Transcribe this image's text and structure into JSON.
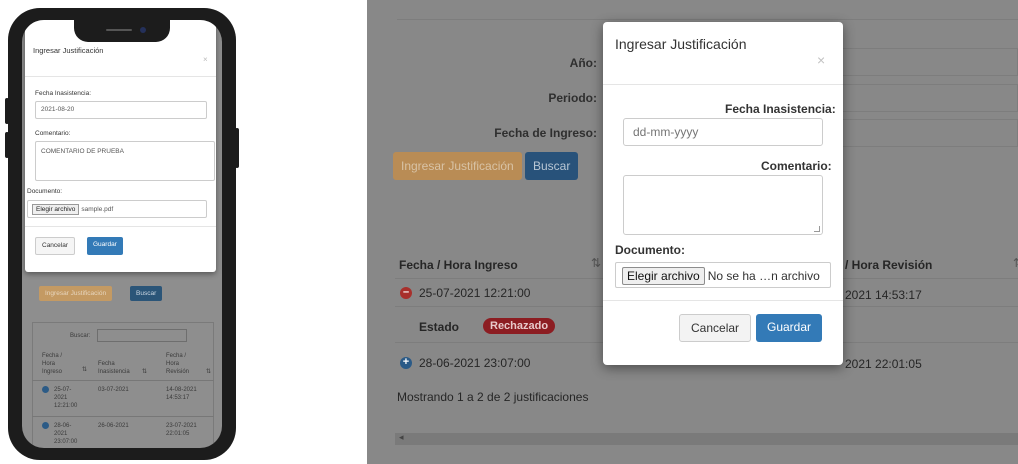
{
  "mobile": {
    "modal": {
      "title": "Ingresar Justificación",
      "close": "×",
      "fecha_label": "Fecha Inasistencia:",
      "fecha_value": "2021-08-20",
      "comentario_label": "Comentario:",
      "comentario_value": "COMENTARIO DE PRUEBA",
      "documento_label": "Documento:",
      "file_button": "Elegir archivo",
      "file_name": "sample.pdf",
      "cancel": "Cancelar",
      "save": "Guardar"
    },
    "background": {
      "btn_ingresar": "Ingresar Justificación",
      "btn_buscar": "Buscar",
      "search_label": "Buscar:",
      "col1": [
        "Fecha /",
        "Hora",
        "Ingreso"
      ],
      "col2": [
        "Fecha",
        "Inasistencia"
      ],
      "col3": [
        "Fecha /",
        "Hora",
        "Revisión"
      ],
      "rows": [
        {
          "ingreso": [
            "25-07-",
            "2021",
            "12:21:00"
          ],
          "inasistencia": "03-07-2021",
          "revision": [
            "14-08-2021",
            "14:53:17"
          ]
        },
        {
          "ingreso": [
            "28-06-",
            "2021",
            "23:07:00"
          ],
          "inasistencia": "26-06-2021",
          "revision": [
            "23-07-2021",
            "22:01:05"
          ]
        }
      ]
    }
  },
  "desktop": {
    "filters": {
      "anio_label": "Año:",
      "periodo_label": "Periodo:",
      "fecha_ingreso_label": "Fecha de Ingreso:"
    },
    "buttons": {
      "ingresar": "Ingresar Justificación",
      "buscar": "Buscar"
    },
    "table": {
      "col_ingreso": "Fecha / Hora Ingreso",
      "col_revision": "/ Hora Revisión",
      "rows": [
        {
          "ingreso": "25-07-2021 12:21:00",
          "revision": "2021 14:53:17",
          "expanded": true,
          "icon": "minus"
        },
        {
          "ingreso": "28-06-2021 23:07:00",
          "revision": "2021 22:01:05",
          "expanded": false,
          "icon": "plus"
        }
      ],
      "estado_label": "Estado",
      "estado_badge": "Rechazado",
      "footer": "Mostrando 1 a 2 de 2 justificaciones"
    },
    "modal": {
      "title": "Ingresar Justificación",
      "close": "×",
      "fecha_label": "Fecha Inasistencia:",
      "fecha_placeholder": "dd-mm-yyyy",
      "comentario_label": "Comentario:",
      "documento_label": "Documento:",
      "file_button": "Elegir archivo",
      "file_status": "No se ha …n archivo",
      "cancel": "Cancelar",
      "save": "Guardar"
    }
  },
  "colors": {
    "primary": "#337ab7",
    "warning": "#f0ad4e",
    "danger": "#d9534f"
  }
}
